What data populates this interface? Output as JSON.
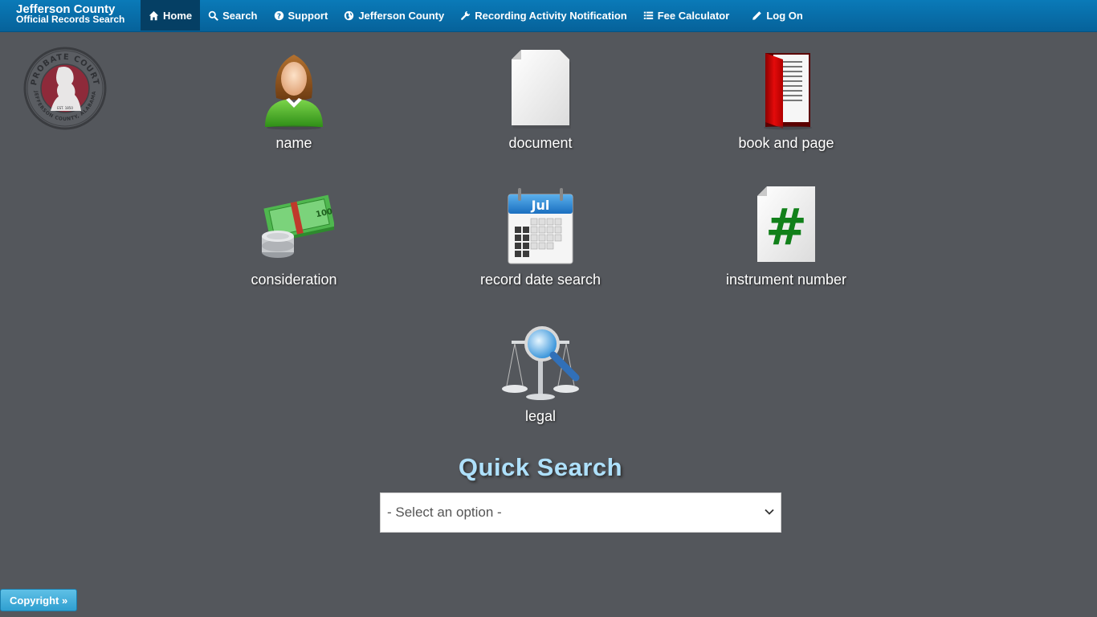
{
  "brand": {
    "line1": "Jefferson County",
    "line2": "Official Records Search"
  },
  "nav": [
    {
      "label": "Home",
      "icon": "home-icon"
    },
    {
      "label": "Search",
      "icon": "search-icon"
    },
    {
      "label": "Support",
      "icon": "question-icon"
    },
    {
      "label": "Jefferson County",
      "icon": "globe-icon"
    },
    {
      "label": "Recording Activity Notification",
      "icon": "wrench-icon"
    },
    {
      "label": "Fee Calculator",
      "icon": "list-icon"
    },
    {
      "label": "Log On",
      "icon": "pencil-icon"
    }
  ],
  "seal": {
    "top_text": "PROBATE COURT",
    "bottom_text": "JEFFERSON COUNTY, ALABAMA",
    "est": "EST. 1850"
  },
  "tiles": [
    {
      "label": "name",
      "icon": "person-icon"
    },
    {
      "label": "document",
      "icon": "document-icon"
    },
    {
      "label": "book and page",
      "icon": "book-icon"
    },
    {
      "label": "consideration",
      "icon": "money-icon"
    },
    {
      "label": "record date search",
      "icon": "calendar-icon"
    },
    {
      "label": "instrument number",
      "icon": "hash-document-icon"
    },
    {
      "label": "legal",
      "icon": "scales-icon"
    }
  ],
  "calendar_month": "Jul",
  "quick_search": {
    "title": "Quick Search",
    "selected": "- Select an option -"
  },
  "footer": {
    "copyright_label": "Copyright »"
  },
  "colors": {
    "navbar": "#0a7ab8",
    "background": "#54575c",
    "quick_search_title": "#aee0fb"
  }
}
